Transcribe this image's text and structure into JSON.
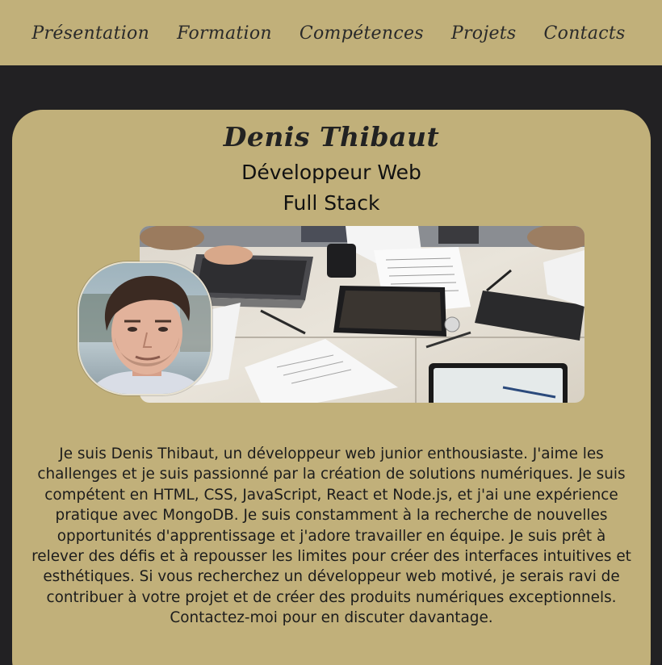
{
  "nav": {
    "items": [
      {
        "label": "Présentation"
      },
      {
        "label": "Formation"
      },
      {
        "label": "Compétences"
      },
      {
        "label": "Projets"
      },
      {
        "label": "Contacts"
      }
    ]
  },
  "profile": {
    "name": "Denis Thibaut",
    "role_line1": "Développeur Web",
    "role_line2": "Full Stack",
    "bio": "Je suis Denis Thibaut, un développeur web junior enthousiaste. J'aime les challenges et je suis passionné par la création de solutions numériques. Je suis compétent en HTML, CSS, JavaScript, React et Node.js, et j'ai une expérience pratique avec MongoDB. Je suis constamment à la recherche de nouvelles opportunités d'apprentissage et j'adore travailler en équipe. Je suis prêt à relever des défis et à repousser les limites pour créer des interfaces intuitives et esthétiques. Si vous recherchez un développeur web motivé, je serais ravi de contribuer à votre projet et de créer des produits numériques exceptionnels. Contactez-moi pour en discuter davantage."
  },
  "colors": {
    "background": "#222123",
    "accent": "#c1b07a",
    "text": "#1e1e1e"
  }
}
